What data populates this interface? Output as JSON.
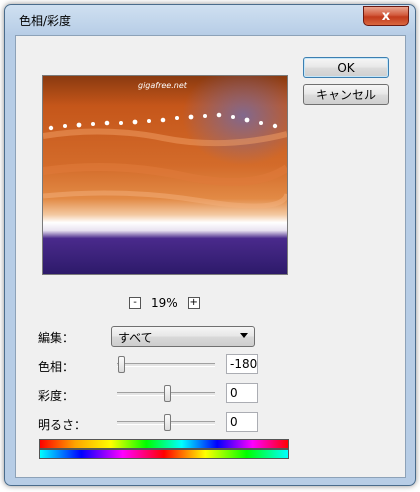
{
  "window": {
    "title": "色相/彩度",
    "close_label": "x"
  },
  "preview": {
    "watermark": "gigafree.net"
  },
  "buttons": {
    "ok": "OK",
    "cancel": "キャンセル"
  },
  "zoom": {
    "minus": "-",
    "value": "19%",
    "plus": "+"
  },
  "edit": {
    "label": "編集：",
    "selected": "すべて"
  },
  "hue": {
    "label": "色相：",
    "value": "-180"
  },
  "saturation": {
    "label": "彩度：",
    "value": "0"
  },
  "lightness": {
    "label": "明るさ：",
    "value": "0"
  }
}
